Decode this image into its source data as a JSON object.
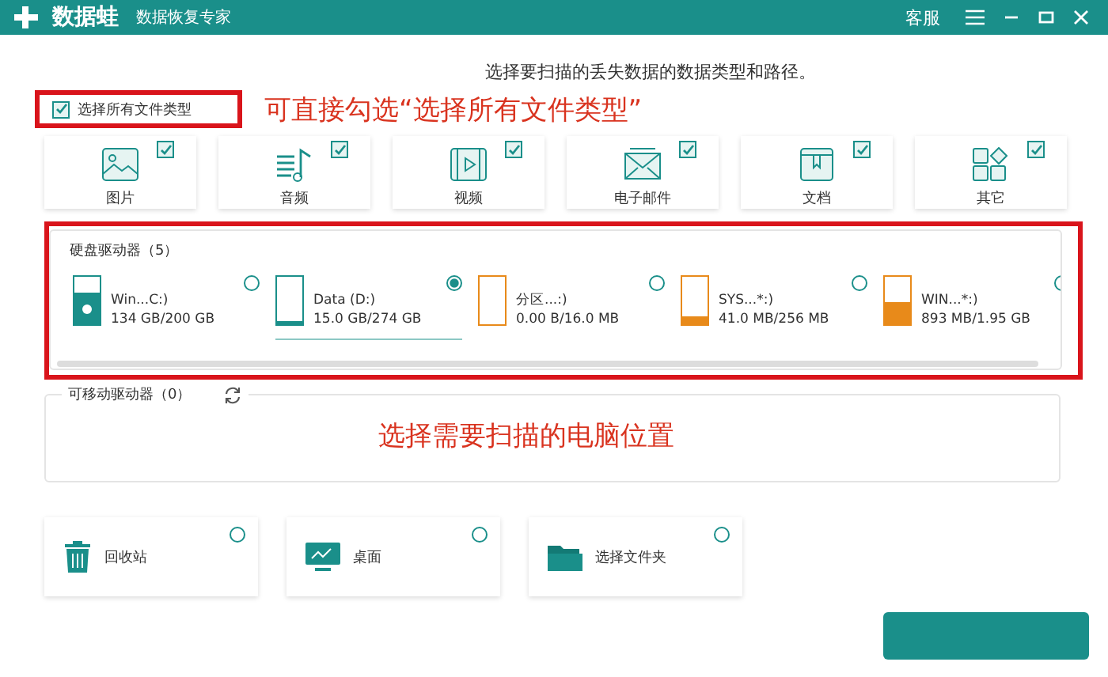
{
  "window": {
    "app_name": "数据蛙",
    "subtitle": "数据恢复专家",
    "support": "客服"
  },
  "instruction": "选择要扫描的丢失数据的数据类型和路径。",
  "select_all": {
    "label": "选择所有文件类型",
    "checked": true
  },
  "annotations": [
    "可直接勾选“选择所有文件类型”",
    "选择需要扫描的电脑位置"
  ],
  "file_types": [
    {
      "kind": "image",
      "label": "图片",
      "checked": true
    },
    {
      "kind": "audio",
      "label": "音频",
      "checked": true
    },
    {
      "kind": "video",
      "label": "视频",
      "checked": true
    },
    {
      "kind": "email",
      "label": "电子邮件",
      "checked": true
    },
    {
      "kind": "document",
      "label": "文档",
      "checked": true
    },
    {
      "kind": "other",
      "label": "其它",
      "checked": true
    }
  ],
  "hard_drives": {
    "title": "硬盘驱动器（5）",
    "drives": [
      {
        "kind": "system",
        "name": "Win...C:)",
        "usage": "134 GB/200 GB",
        "level": 0.67,
        "color": "#1a8f8a",
        "selected": false
      },
      {
        "kind": "disk",
        "name": "Data (D:)",
        "usage": "15.0 GB/274 GB",
        "level": 0.06,
        "color": "#1a8f8a",
        "selected": true
      },
      {
        "kind": "disk",
        "name": "分区...:)",
        "usage": "0.00 B/16.0 MB",
        "level": 0,
        "color": "#e88a1a",
        "selected": false
      },
      {
        "kind": "disk",
        "name": "SYS...*:)",
        "usage": "41.0 MB/256 MB",
        "level": 0.16,
        "color": "#e88a1a",
        "selected": false
      },
      {
        "kind": "disk",
        "name": "WIN...*:)",
        "usage": "893 MB/1.95 GB",
        "level": 0.46,
        "color": "#e88a1a",
        "selected": false
      }
    ]
  },
  "removable_drives": {
    "title": "可移动驱动器（0）"
  },
  "locations": [
    {
      "kind": "recycle",
      "label": "回收站",
      "selected": false
    },
    {
      "kind": "desktop",
      "label": "桌面",
      "selected": false
    },
    {
      "kind": "folder",
      "label": "选择文件夹",
      "selected": false
    }
  ]
}
